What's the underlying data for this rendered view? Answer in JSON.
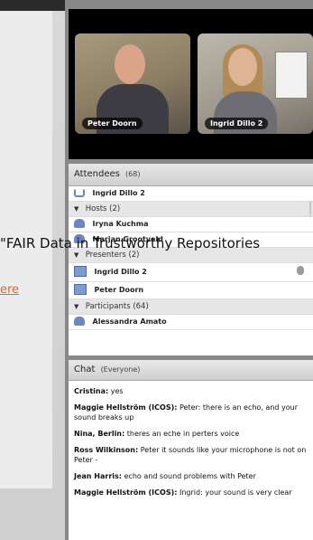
{
  "overlay": {
    "banner_text": "\"FAIR Data in Trustworthy Repositories",
    "link_text": "ere"
  },
  "video": {
    "tiles": [
      {
        "name": "Peter Doorn"
      },
      {
        "name": "Ingrid Dillo 2"
      }
    ]
  },
  "attendees": {
    "title": "Attendees",
    "count": "(68)",
    "phone_row": "Ingrid Dillo 2",
    "groups": [
      {
        "label": "Hosts (2)",
        "members": [
          "Iryna Kuchma",
          "Marjan Grootveld"
        ]
      },
      {
        "label": "Presenters (2)",
        "members": [
          "Ingrid Dillo 2",
          "Peter Doorn"
        ]
      },
      {
        "label": "Participants (64)",
        "members": [
          "Alessandra Amato"
        ]
      }
    ]
  },
  "chat": {
    "title": "Chat",
    "scope": "(Everyone)",
    "messages": [
      {
        "who": "Cristina:",
        "text": " yes"
      },
      {
        "who": "Maggie Hellström (ICOS):",
        "text": " Peter: there is an echo, and your sound breaks up"
      },
      {
        "who": "Nina, Berlin:",
        "text": " theres an eche in perters voice"
      },
      {
        "who": "Ross Wilkinson:",
        "text": " Peter it sounds like your microphone is not on Peter -"
      },
      {
        "who": "Jean Harris:",
        "text": " echo and sound problems with Peter"
      },
      {
        "who": "Maggie Hellström (ICOS):",
        "text": " Ingrid: your sound is very clear"
      }
    ]
  }
}
